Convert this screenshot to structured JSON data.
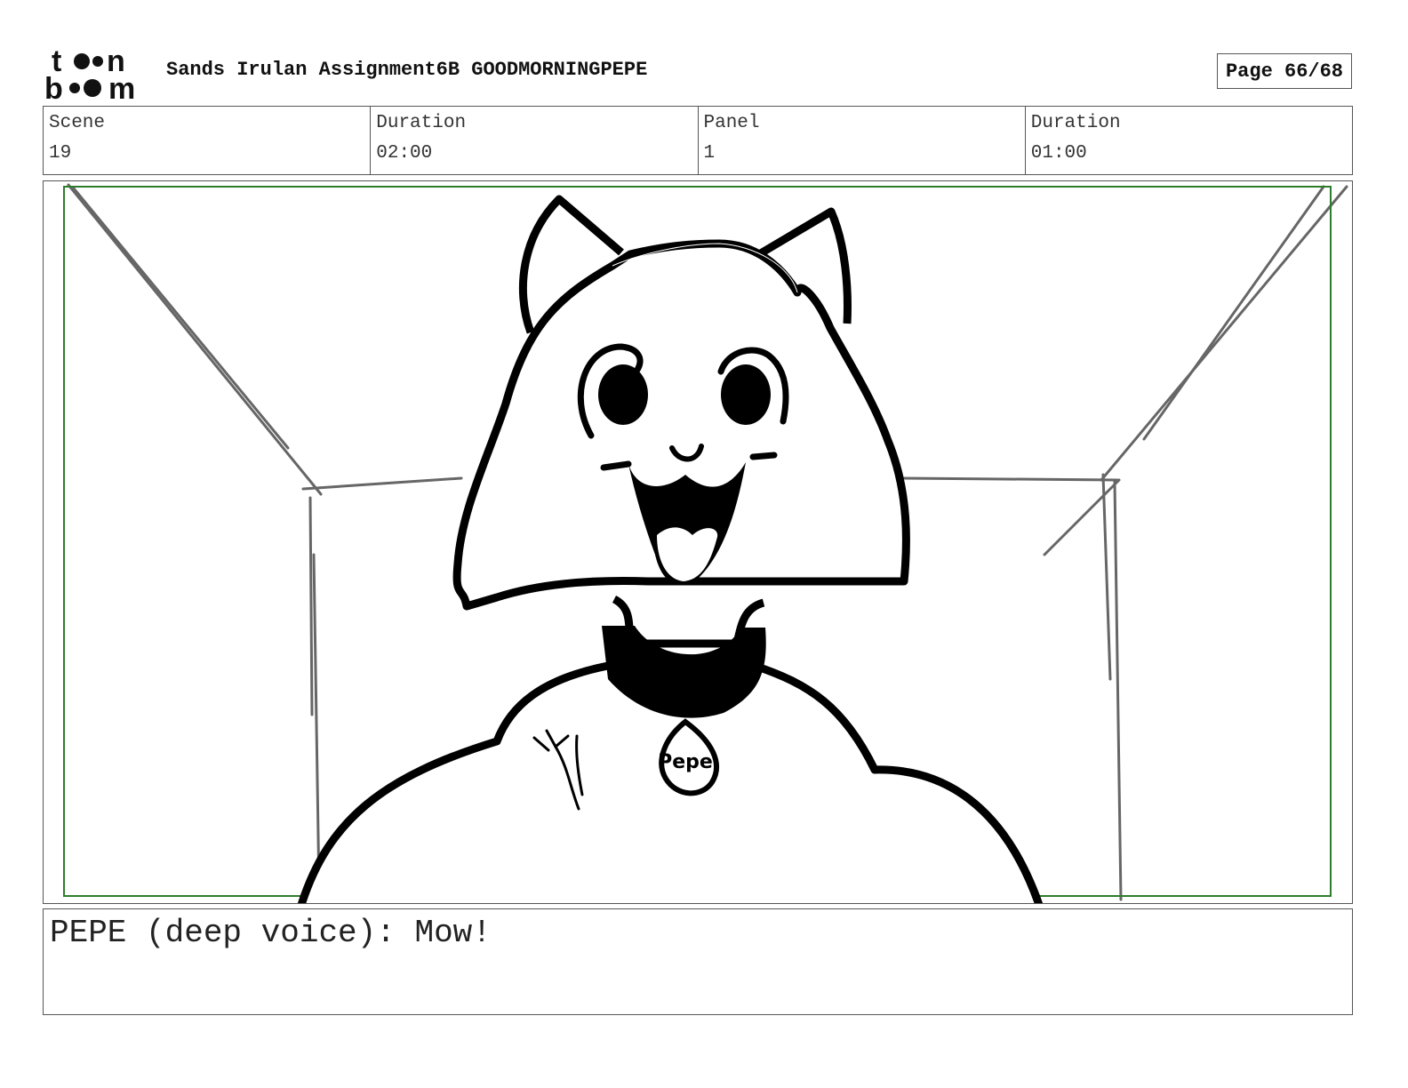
{
  "header": {
    "logo_text": [
      "toon",
      "boom"
    ],
    "title": "Sands Irulan Assignment6B GOODMORNINGPEPE",
    "page": "Page 66/68"
  },
  "info": {
    "scene_label": "Scene",
    "scene_value": "19",
    "scene_duration_label": "Duration",
    "scene_duration_value": "02:00",
    "panel_label": "Panel",
    "panel_value": "1",
    "panel_duration_label": "Duration",
    "panel_duration_value": "01:00"
  },
  "panel": {
    "safe_frame_color": "#2e7d2e",
    "collar_tag_text": "Pepe"
  },
  "dialogue": {
    "text": "PEPE (deep voice): Mow!"
  }
}
